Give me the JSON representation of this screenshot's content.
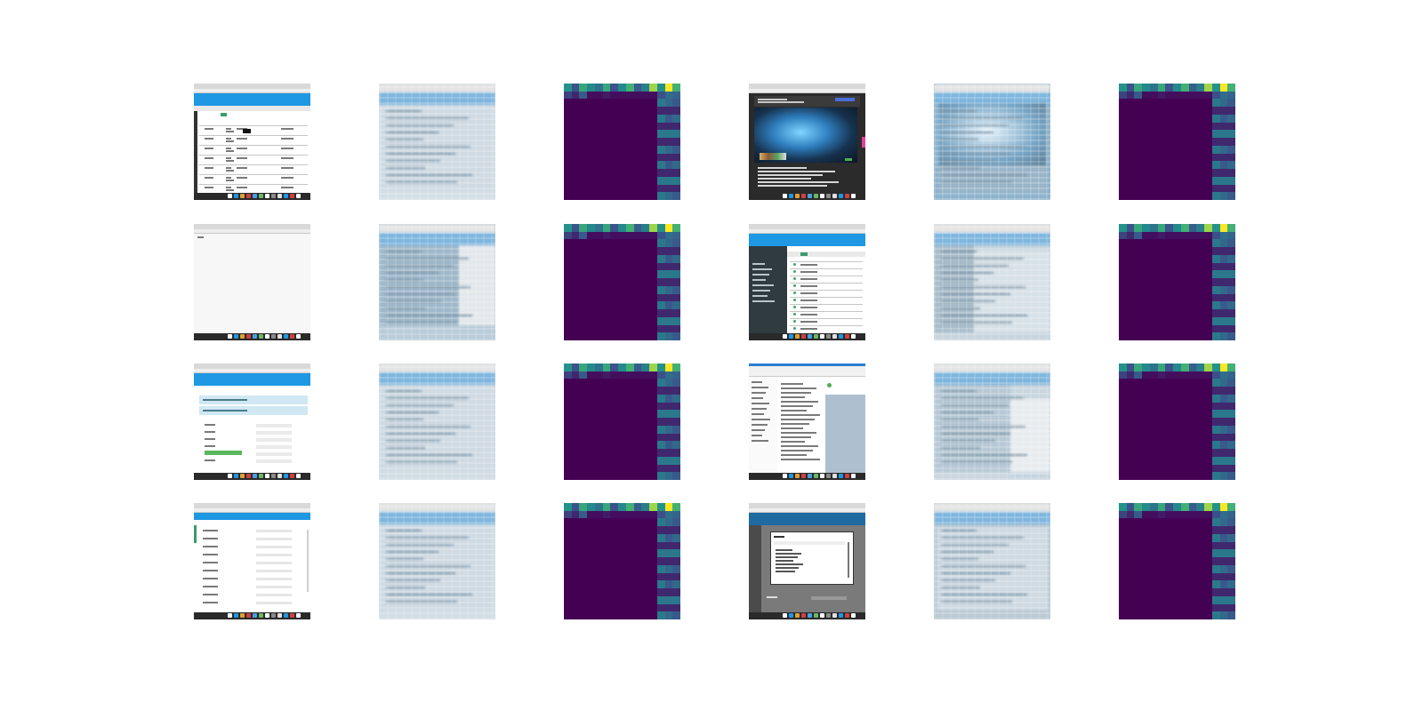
{
  "figure": {
    "rows": 4,
    "columns": 6,
    "colors": {
      "background": "#ffffff",
      "accent_blue": "#1e98e3",
      "heatmap_low": "#440154",
      "heatmap_mid": "#31688e",
      "heatmap_high": "#35b779",
      "heatmap_max": "#fde725"
    },
    "panels": [
      {
        "row": 0,
        "col": 0,
        "kind": "screenshot",
        "variant": "table"
      },
      {
        "row": 0,
        "col": 1,
        "kind": "reconstruction",
        "variant": "table"
      },
      {
        "row": 0,
        "col": 2,
        "kind": "heatmap"
      },
      {
        "row": 0,
        "col": 3,
        "kind": "screenshot",
        "variant": "game-dialog"
      },
      {
        "row": 0,
        "col": 4,
        "kind": "reconstruction",
        "variant": "game-dialog"
      },
      {
        "row": 0,
        "col": 5,
        "kind": "heatmap"
      },
      {
        "row": 1,
        "col": 0,
        "kind": "screenshot",
        "variant": "blank"
      },
      {
        "row": 1,
        "col": 1,
        "kind": "reconstruction",
        "variant": "blank"
      },
      {
        "row": 1,
        "col": 2,
        "kind": "heatmap"
      },
      {
        "row": 1,
        "col": 3,
        "kind": "screenshot",
        "variant": "dark-sidebar-list"
      },
      {
        "row": 1,
        "col": 4,
        "kind": "reconstruction",
        "variant": "dark-sidebar-list"
      },
      {
        "row": 1,
        "col": 5,
        "kind": "heatmap"
      },
      {
        "row": 2,
        "col": 0,
        "kind": "screenshot",
        "variant": "form"
      },
      {
        "row": 2,
        "col": 1,
        "kind": "reconstruction",
        "variant": "form"
      },
      {
        "row": 2,
        "col": 2,
        "kind": "heatmap"
      },
      {
        "row": 2,
        "col": 3,
        "kind": "screenshot",
        "variant": "document-tree"
      },
      {
        "row": 2,
        "col": 4,
        "kind": "reconstruction",
        "variant": "document-tree"
      },
      {
        "row": 2,
        "col": 5,
        "kind": "heatmap"
      },
      {
        "row": 3,
        "col": 0,
        "kind": "screenshot",
        "variant": "settings"
      },
      {
        "row": 3,
        "col": 1,
        "kind": "reconstruction",
        "variant": "settings"
      },
      {
        "row": 3,
        "col": 2,
        "kind": "heatmap"
      },
      {
        "row": 3,
        "col": 3,
        "kind": "screenshot",
        "variant": "modal-dialog"
      },
      {
        "row": 3,
        "col": 4,
        "kind": "reconstruction",
        "variant": "modal-dialog"
      },
      {
        "row": 3,
        "col": 5,
        "kind": "heatmap"
      }
    ]
  }
}
